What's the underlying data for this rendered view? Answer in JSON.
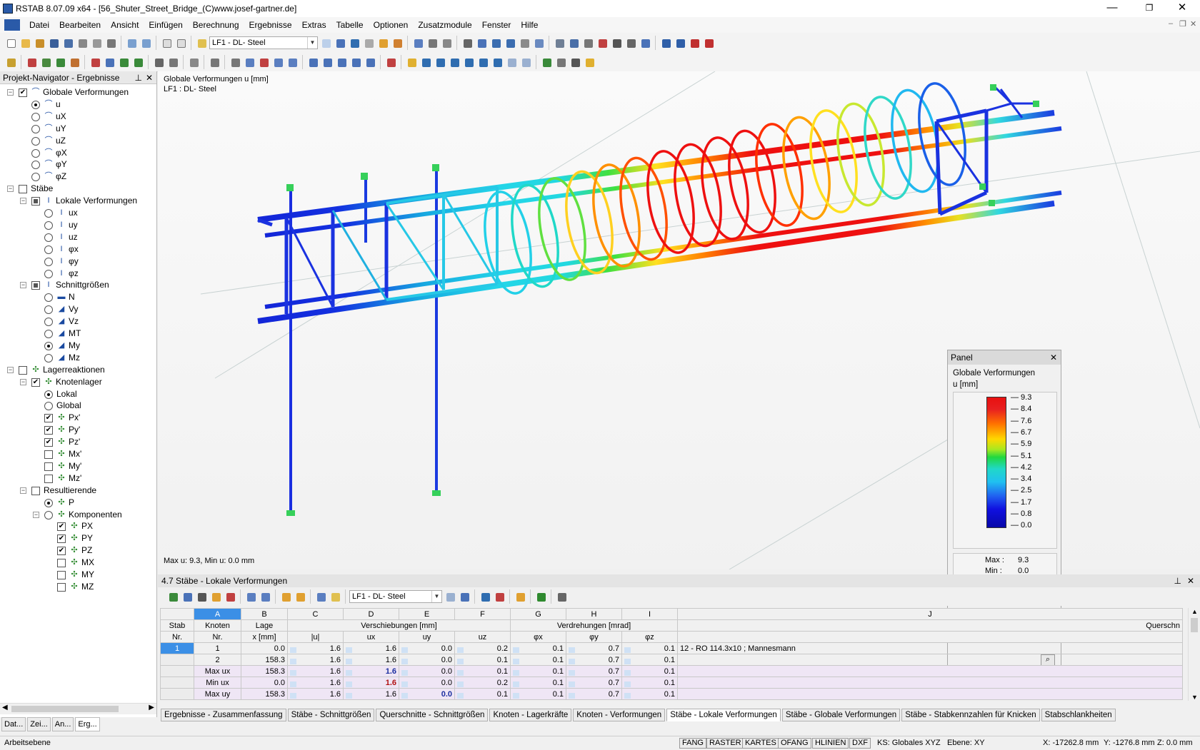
{
  "window": {
    "title": "RSTAB 8.07.09 x64 - [56_Shuter_Street_Bridge_(C)www.josef-gartner.de]",
    "minimize": "—",
    "maximize": "❐",
    "close": "✕"
  },
  "menu": [
    "Datei",
    "Bearbeiten",
    "Ansicht",
    "Einfügen",
    "Berechnung",
    "Ergebnisse",
    "Extras",
    "Tabelle",
    "Optionen",
    "Zusatzmodule",
    "Fenster",
    "Hilfe"
  ],
  "toolbar": {
    "loadcase": "LF1 - DL- Steel"
  },
  "navigator": {
    "title": "Projekt-Navigator - Ergebnisse",
    "items": {
      "glob": "Globale Verformungen",
      "u": "u",
      "ux": "uX",
      "uy": "uY",
      "uz": "uZ",
      "px": "φX",
      "py": "φY",
      "pz": "φZ",
      "staebe": "Stäbe",
      "lokal": "Lokale Verformungen",
      "lux": "ux",
      "luy": "uy",
      "luz": "uz",
      "lpx": "φx",
      "lpy": "φy",
      "lpz": "φz",
      "schnitt": "Schnittgrößen",
      "N": "N",
      "Vy": "Vy",
      "Vz": "Vz",
      "MT": "MT",
      "My": "My",
      "Mz": "Mz",
      "lager": "Lagerreaktionen",
      "knoten": "Knotenlager",
      "lokal2": "Lokal",
      "global": "Global",
      "Px1": "Px'",
      "Py1": "Py'",
      "Pz1": "Pz'",
      "Mx1": "Mx'",
      "My1": "My'",
      "Mz1": "Mz'",
      "result": "Resultierende",
      "P": "P",
      "komp": "Komponenten",
      "PX": "PX",
      "PY": "PY",
      "PZ": "PZ",
      "MX": "MX",
      "MY": "MY",
      "MZ": "MZ"
    },
    "tabs": [
      "Dat...",
      "Zei...",
      "An...",
      "Erg..."
    ]
  },
  "view": {
    "label1": "Globale Verformungen u [mm]",
    "label2": "LF1 : DL- Steel",
    "footer": "Max u: 9.3, Min u: 0.0 mm"
  },
  "panel": {
    "title": "Panel",
    "heading1": "Globale Verformungen",
    "heading2": "u [mm]",
    "scale": [
      "9.3",
      "8.4",
      "7.6",
      "6.7",
      "5.9",
      "5.1",
      "4.2",
      "3.4",
      "2.5",
      "1.7",
      "0.8",
      "0.0"
    ],
    "max_label": "Max :",
    "max": "9.3",
    "min_label": "Min :",
    "min": "0.0"
  },
  "table": {
    "title": "4.7 Stäbe - Lokale Verformungen",
    "loadcase": "LF1 - DL- Steel",
    "cols": [
      "A",
      "B",
      "C",
      "D",
      "E",
      "F",
      "G",
      "H",
      "I",
      "J"
    ],
    "h_stab": "Stab",
    "h_nr": "Nr.",
    "h_knoten": "Knoten",
    "h_knr": "Nr.",
    "h_lage": "Lage",
    "h_x": "x [mm]",
    "h_versch": "Verschiebungen [mm]",
    "h_u": "|u|",
    "h_ux": "ux",
    "h_uy": "uy",
    "h_uz": "uz",
    "h_verdr": "Verdrehungen [mrad]",
    "h_px": "φx",
    "h_py": "φy",
    "h_pz": "φz",
    "h_quer": "Querschn",
    "rows": [
      {
        "stab": "1",
        "knoten": "1",
        "x": "0.0",
        "u": "1.6",
        "ux": "1.6",
        "uy": "0.0",
        "uz": "0.2",
        "px": "0.1",
        "py": "0.7",
        "pz": "0.1",
        "q": "12 - RO 114.3x10 ; Mannesmann"
      },
      {
        "stab": "",
        "knoten": "2",
        "x": "158.3",
        "u": "1.6",
        "ux": "1.6",
        "uy": "0.0",
        "uz": "0.1",
        "px": "0.1",
        "py": "0.7",
        "pz": "0.1",
        "q": ""
      },
      {
        "stab": "",
        "knoten": "Max ux",
        "x": "158.3",
        "u": "1.6",
        "ux": "1.6",
        "uy": "0.0",
        "uz": "0.1",
        "px": "0.1",
        "py": "0.7",
        "pz": "0.1",
        "q": ""
      },
      {
        "stab": "",
        "knoten": "Min ux",
        "x": "0.0",
        "u": "1.6",
        "ux": "1.6",
        "uy": "0.0",
        "uz": "0.2",
        "px": "0.1",
        "py": "0.7",
        "pz": "0.1",
        "q": ""
      },
      {
        "stab": "",
        "knoten": "Max uy",
        "x": "158.3",
        "u": "1.6",
        "ux": "1.6",
        "uy": "0.0",
        "uz": "0.1",
        "px": "0.1",
        "py": "0.7",
        "pz": "0.1",
        "q": ""
      }
    ]
  },
  "bottom_tabs": [
    "Ergebnisse - Zusammenfassung",
    "Stäbe - Schnittgrößen",
    "Querschnitte - Schnittgrößen",
    "Knoten - Lagerkräfte",
    "Knoten - Verformungen",
    "Stäbe - Lokale Verformungen",
    "Stäbe - Globale Verformungen",
    "Stäbe - Stabkennzahlen für Knicken",
    "Stabschlankheiten"
  ],
  "status": {
    "left": "Arbeitsebene",
    "buttons": [
      "FANG",
      "RASTER",
      "KARTES",
      "OFANG",
      "HLINIEN",
      "DXF"
    ],
    "ks": "KS: Globales XYZ",
    "ebene": "Ebene: XY",
    "x": "X: -17262.8 mm",
    "y": "Y: -1276.8 mm",
    "z": "Z: 0.0 mm"
  }
}
